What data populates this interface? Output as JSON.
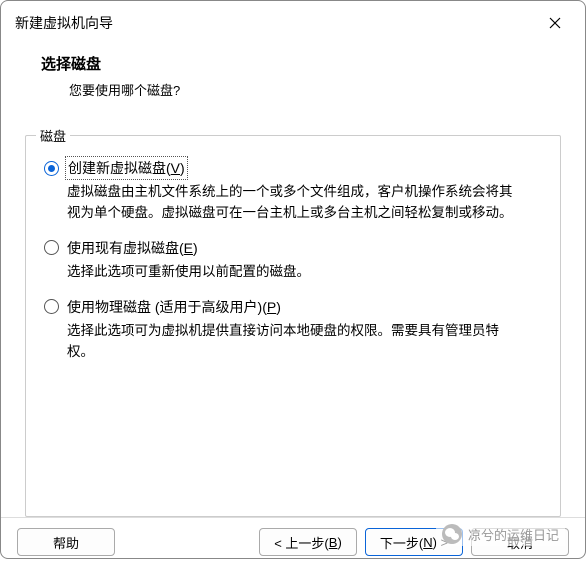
{
  "window": {
    "title": "新建虚拟机向导"
  },
  "header": {
    "heading": "选择磁盘",
    "sub": "您要使用哪个磁盘?"
  },
  "group": {
    "legend": "磁盘",
    "options": [
      {
        "label_pre": "创建新虚拟磁盘(",
        "mnemonic": "V",
        "label_post": ")",
        "desc": "虚拟磁盘由主机文件系统上的一个或多个文件组成，客户机操作系统会将其视为单个硬盘。虚拟磁盘可在一台主机上或多台主机之间轻松复制或移动。",
        "checked": true
      },
      {
        "label_pre": "使用现有虚拟磁盘(",
        "mnemonic": "E",
        "label_post": ")",
        "desc": "选择此选项可重新使用以前配置的磁盘。",
        "checked": false
      },
      {
        "label_pre": "使用物理磁盘 (适用于高级用户)(",
        "mnemonic": "P",
        "label_post": ")",
        "desc": "选择此选项可为虚拟机提供直接访问本地硬盘的权限。需要具有管理员特权。",
        "checked": false
      }
    ]
  },
  "footer": {
    "help": "帮助",
    "back_pre": "< 上一步(",
    "back_m": "B",
    "back_post": ")",
    "next_pre": "下一步(",
    "next_m": "N",
    "next_post": ") >",
    "cancel": "取消"
  },
  "watermark": "凉兮的运维日记"
}
